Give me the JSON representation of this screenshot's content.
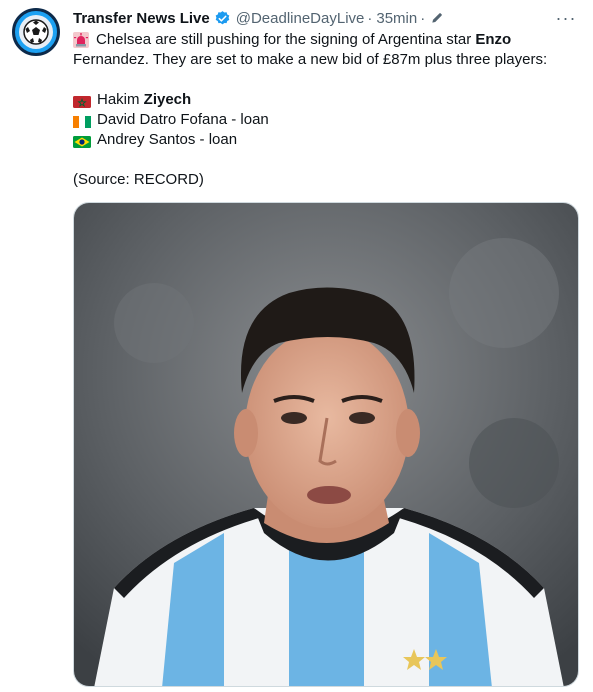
{
  "tweet": {
    "author_name": "Transfer News Live",
    "author_handle": "@DeadlineDayLive",
    "separator": "·",
    "time": "35min",
    "separator2": "·",
    "line1_before": "Chelsea are still pushing for the signing of Argentina star ",
    "line1_bold": "Enzo",
    "line2": "Fernandez. They are set to make a new bid of £87m plus three players:",
    "players": [
      {
        "first": "Hakim ",
        "bold": "Ziyech",
        "rest": "",
        "flag_icon": "morocco-flag-icon"
      },
      {
        "first": "David Datro Fofana - loan",
        "bold": "",
        "rest": "",
        "flag_icon": "ivory-coast-flag-icon"
      },
      {
        "first": "Andrey Santos - loan",
        "bold": "",
        "rest": "",
        "flag_icon": "brazil-flag-icon"
      }
    ],
    "source": "(Source: RECORD)",
    "more_label": "···"
  },
  "colors": {
    "verified": "#1d9bf0",
    "muted": "#536471",
    "text": "#0f1419",
    "argentina_blue": "#6cb4e4"
  },
  "icons": {
    "siren": "siren-icon",
    "verified": "verified-badge-icon",
    "edit": "edit-pencil-icon",
    "avatar": "soccer-ball-icon"
  }
}
